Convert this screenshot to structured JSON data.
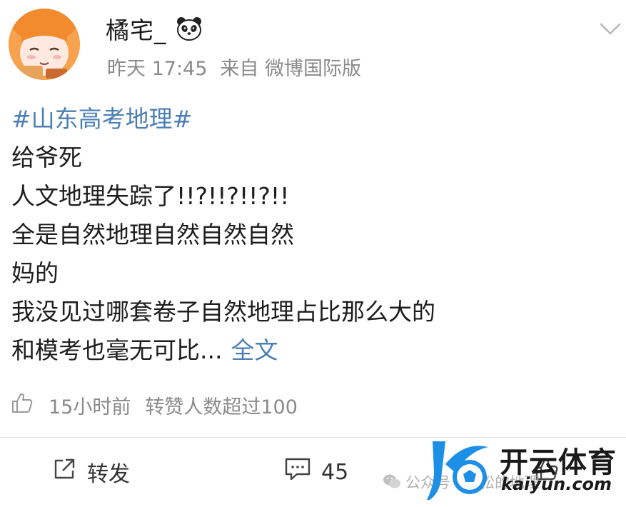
{
  "post": {
    "username": "橘宅_",
    "badge_icon": "panda-icon",
    "time": "昨天 17:45",
    "source": "来自 微博国际版",
    "hashtag": "#山东高考地理#",
    "lines": [
      "给爷死",
      "人文地理失踪了!!?!!?!!?!!",
      "全是自然地理自然自然自然",
      "妈的",
      "我没见过哪套卷子自然地理占比那么大的"
    ],
    "last_line": "和模考也毫无可比...",
    "full_text_link": "全文",
    "likes_time": "15小时前",
    "likes_summary": "转赞人数超过100"
  },
  "actions": {
    "repost_label": "转发",
    "comment_count": "45"
  },
  "watermark": {
    "account_text": "公众号 · 轻松的地理",
    "brand": "开云体育",
    "domain": "kaiyun.com"
  },
  "colors": {
    "link": "#4b7fb5",
    "meta": "#8a8a8a",
    "brand_blue": "#1e8fe6"
  }
}
